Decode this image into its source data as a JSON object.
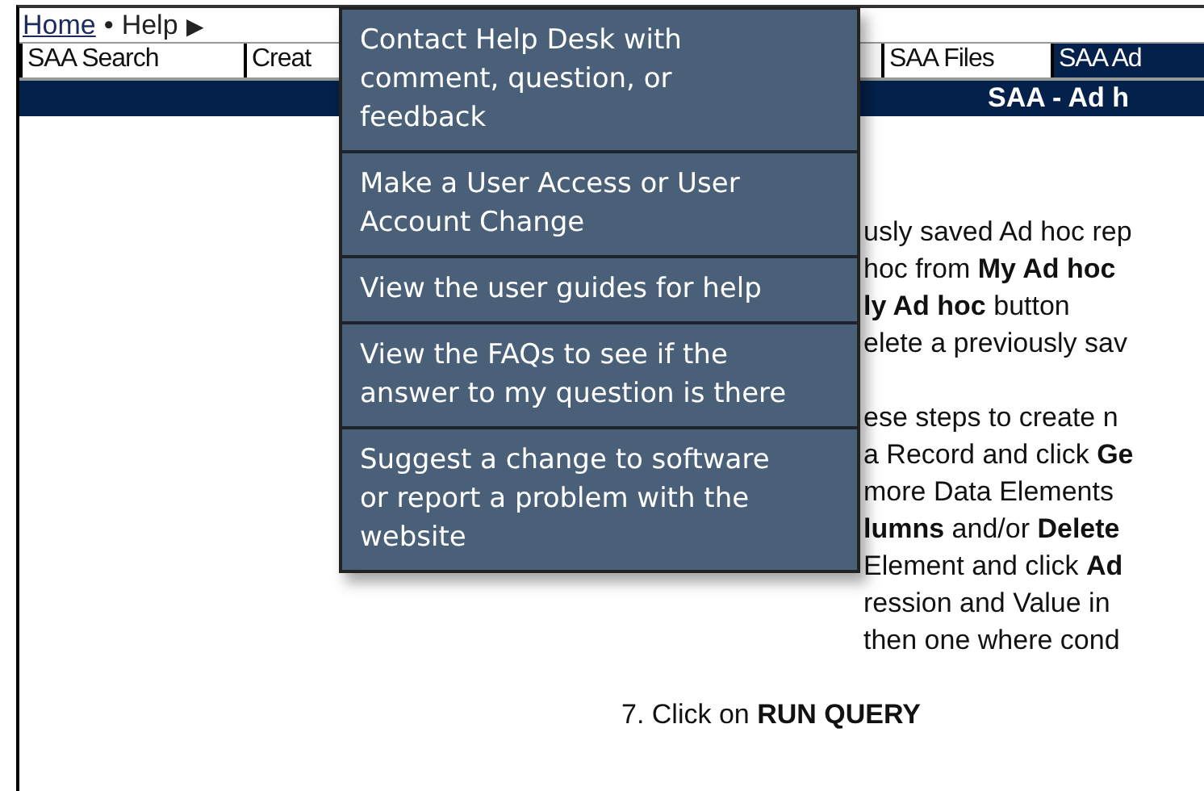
{
  "breadcrumb": {
    "home": "Home",
    "separator": "•",
    "current": "Help",
    "arrow": "▶"
  },
  "tabs": [
    {
      "label": "SAA Search",
      "selected": false
    },
    {
      "label": "Creat",
      "selected": false
    },
    {
      "label": "SAA Files",
      "selected": false
    },
    {
      "label": "SAA Ad",
      "selected": true
    }
  ],
  "header": "SAA - Ad h",
  "body_paragraphs": [
    [
      "usly saved Ad hoc rep",
      "hoc from **My Ad hoc**",
      "**ly Ad hoc** button",
      "elete a previously sav"
    ],
    [
      "ese steps to create n",
      "a Record and click **Ge**",
      "more Data Elements",
      "**lumns** and/or **Delete**",
      "Element and click **Ad**",
      "ression and Value in",
      "then one where cond"
    ]
  ],
  "last_step": "7. Click on **RUN QUERY**",
  "help_menu": [
    "Contact Help Desk with comment, question, or feedback",
    "Make a User Access or User Account Change",
    "View the user guides for help",
    "View the FAQs to see if the answer to my question is there",
    "Suggest a change to software or report a problem with the website"
  ]
}
